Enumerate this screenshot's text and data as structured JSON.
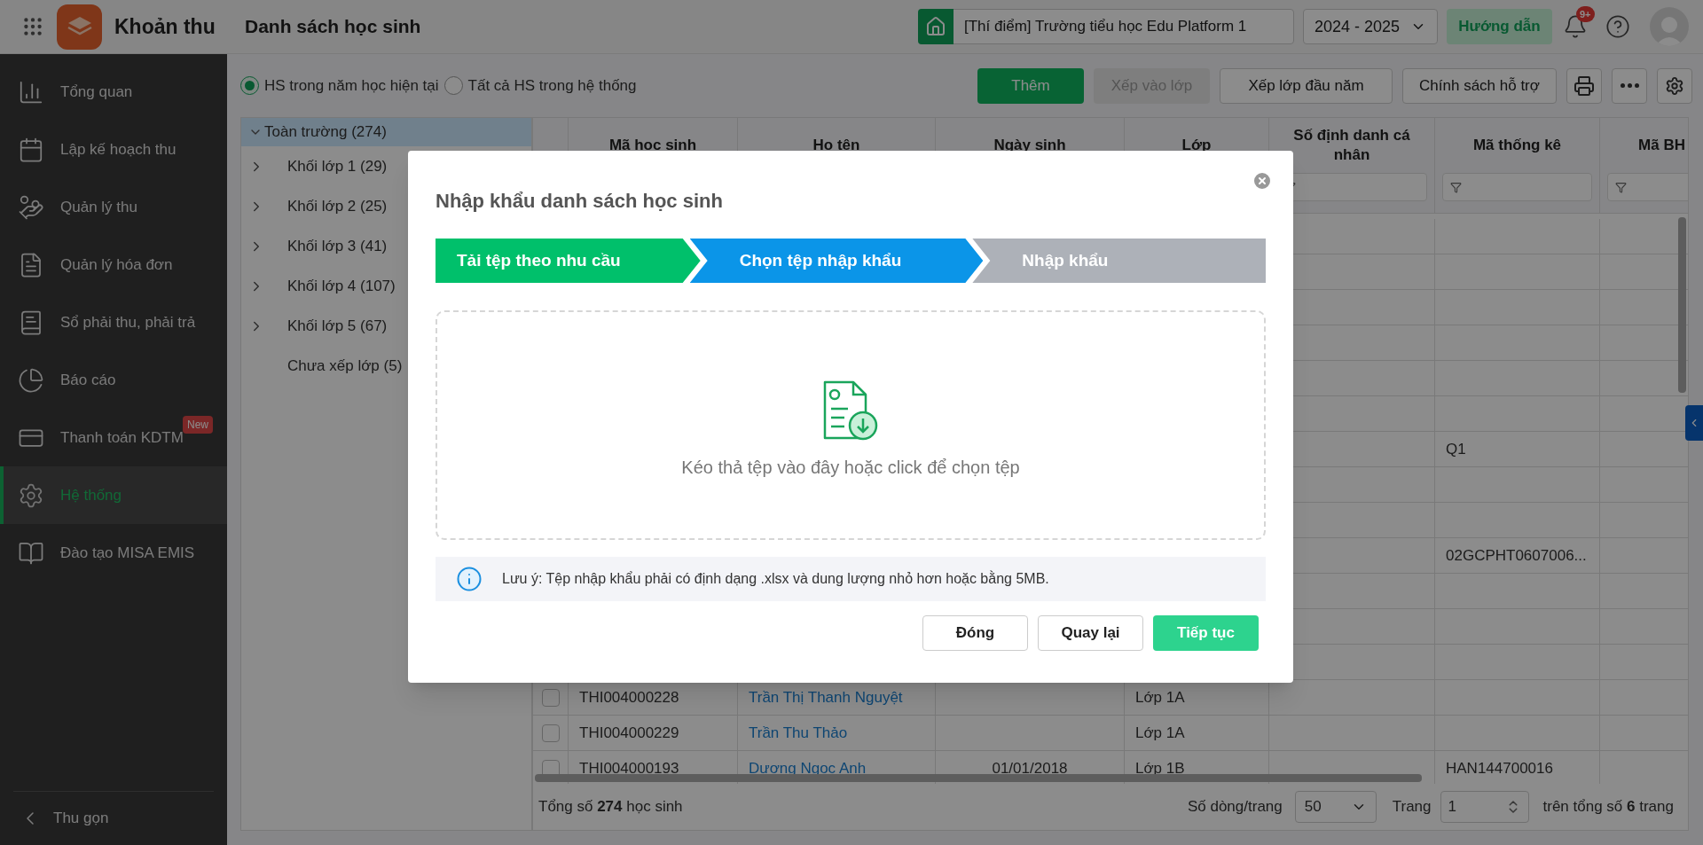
{
  "app": {
    "name": "Khoản thu"
  },
  "page_title": "Danh sách học sinh",
  "header": {
    "school": "[Thí điểm] Trường tiểu học Edu Platform 1",
    "year": "2024 - 2025",
    "guide_button": "Hướng dẫn",
    "notification_badge": "9+"
  },
  "sidebar": {
    "items": [
      {
        "label": "Tổng quan",
        "selected": false
      },
      {
        "label": "Lập kế hoạch thu",
        "selected": false
      },
      {
        "label": "Quản lý thu",
        "selected": false
      },
      {
        "label": "Quản lý hóa đơn",
        "selected": false
      },
      {
        "label": "Sổ phải thu, phải trả",
        "selected": false
      },
      {
        "label": "Báo cáo",
        "selected": false
      },
      {
        "label": "Thanh toán KDTM",
        "selected": false,
        "badge": "New"
      },
      {
        "label": "Hệ thống",
        "selected": true
      },
      {
        "label": "Đào tạo MISA EMIS",
        "selected": false
      }
    ],
    "collapse": "Thu gọn"
  },
  "filters": [
    {
      "label": "HS trong năm học hiện tại",
      "selected": true
    },
    {
      "label": "Tất cả HS trong hệ thống",
      "selected": false
    }
  ],
  "toolbar": {
    "buttons": [
      {
        "label": "Thêm",
        "kind": "primary"
      },
      {
        "label": "Xếp vào lớp",
        "kind": "disabled"
      },
      {
        "label": "Xếp lớp đầu năm",
        "kind": "default"
      },
      {
        "label": "Chính sách hỗ trợ",
        "kind": "default"
      }
    ]
  },
  "tree": {
    "label": "Toàn trường (274)",
    "expanded": true,
    "selected": true,
    "children": [
      {
        "label": "Khối lớp 1 (29)",
        "expanded": false,
        "selected": false
      },
      {
        "label": "Khối lớp 2 (25)",
        "expanded": false,
        "selected": false
      },
      {
        "label": "Khối lớp 3 (41)",
        "expanded": false,
        "selected": false
      },
      {
        "label": "Khối lớp 4 (107)",
        "expanded": false,
        "selected": false
      },
      {
        "label": "Khối lớp 5 (67)",
        "expanded": false,
        "selected": false
      },
      {
        "label": "Chưa xếp lớp (5)",
        "selected": false
      }
    ]
  },
  "table": {
    "columns": [
      "Mã học sinh",
      "Họ tên",
      "Ngày sinh",
      "Lớp",
      "Số định danh cá nhân",
      "Mã thống kê",
      "Mã BH"
    ],
    "rows": [
      {},
      {},
      {},
      {},
      {},
      {},
      {
        "stat_code": "Q1"
      },
      {},
      {},
      {
        "stat_code": "02GCPHT0607006..."
      },
      {},
      {},
      {},
      {
        "checked": false,
        "code": "THI004000228",
        "name": "Trần Thị Thanh Nguyệt",
        "class": "Lớp 1A"
      },
      {
        "checked": false,
        "code": "THI004000229",
        "name": "Trần Thu Thảo",
        "class": "Lớp 1A"
      },
      {
        "checked": false,
        "code": "THI004000193",
        "name": "Dương Ngọc Anh",
        "dob": "01/01/2018",
        "class": "Lớp 1B",
        "stat_code": "HAN144700016"
      }
    ]
  },
  "footer": {
    "total": "Tổng số **274** học sinh",
    "rows_per_page_label": "Số dòng/trang",
    "rows_per_page": "50",
    "page_label": "Trang",
    "page": "1",
    "page_total": "trên tổng số **6** trang"
  },
  "dialog": {
    "title": "Nhập khẩu danh sách học sinh",
    "steps": [
      {
        "label": "Tải tệp theo nhu cầu",
        "kind": "done"
      },
      {
        "label": "Chọn tệp nhập khẩu",
        "kind": "current"
      },
      {
        "label": "Nhập khẩu",
        "kind": "todo"
      }
    ],
    "dropzone_text": "Kéo thả tệp vào đây hoặc click để chọn tệp",
    "note": "Lưu ý: Tệp nhập khẩu phải có định dạng .xlsx và dung lượng nhỏ hơn hoặc bằng 5MB.",
    "buttons": [
      {
        "label": "Đóng",
        "kind": "default"
      },
      {
        "label": "Quay lại",
        "kind": "default"
      },
      {
        "label": "Tiếp tục",
        "kind": "primary"
      }
    ]
  }
}
